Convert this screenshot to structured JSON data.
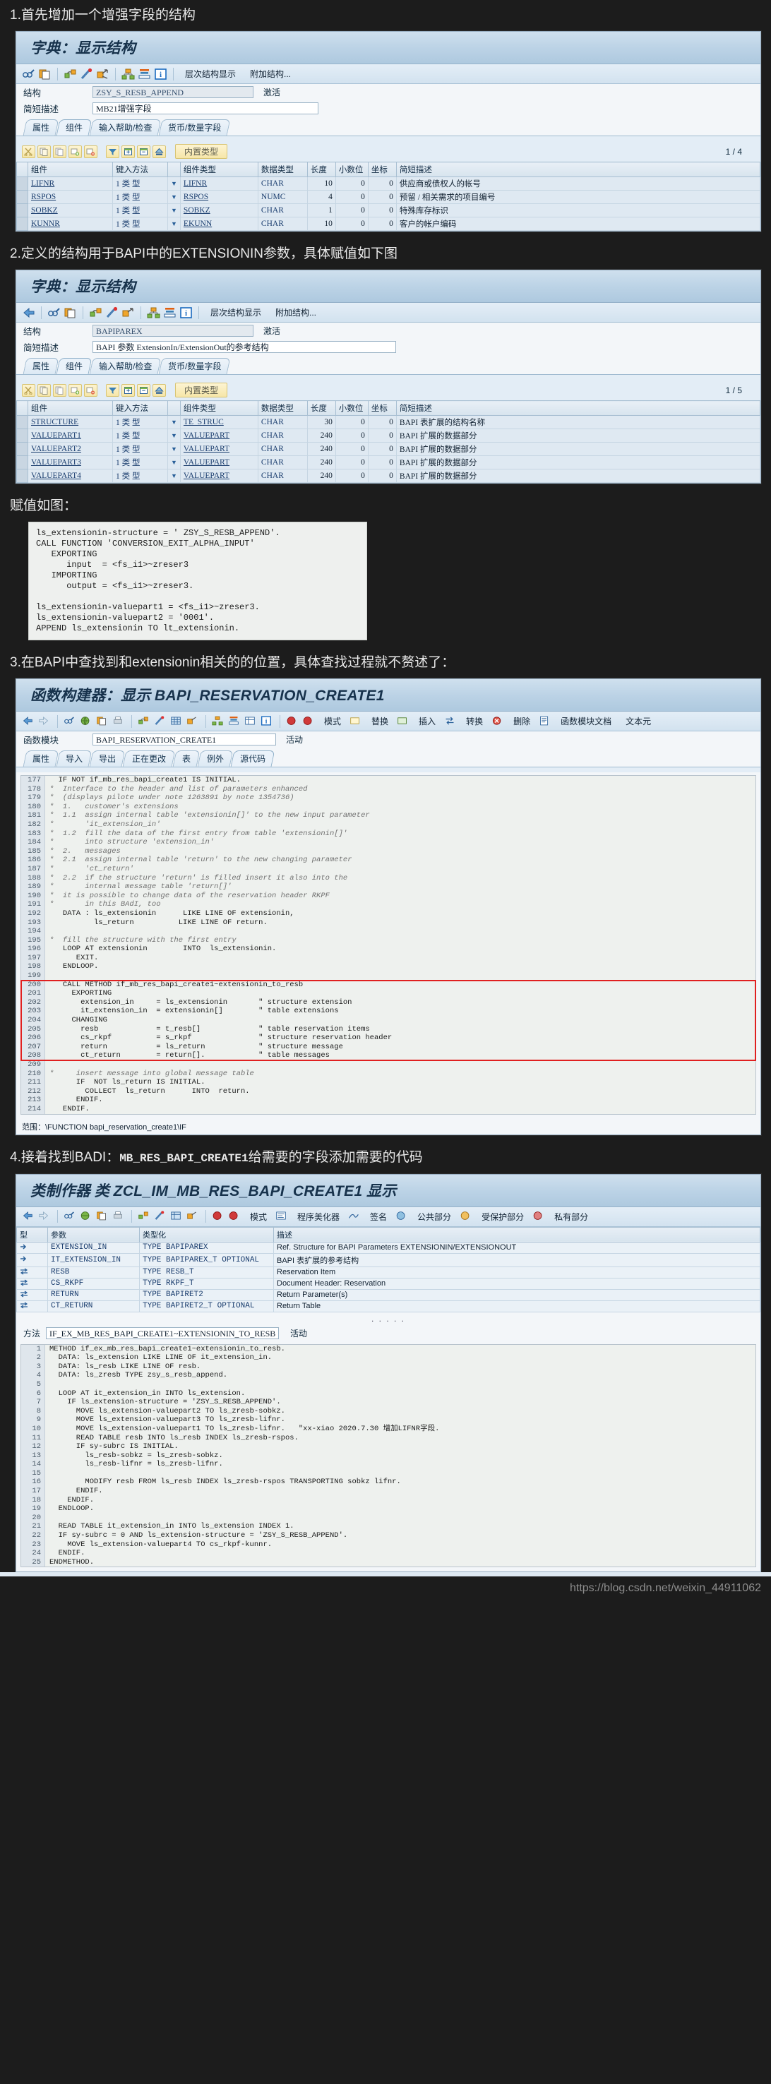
{
  "notes": {
    "n1": "1.首先增加一个增强字段的结构",
    "n2": "2.定义的结构用于BAPI中的EXTENSIONIN参数，具体赋值如下图",
    "n3_label": "赋值如图：",
    "n4_pre": "3.在BAPI中查找到和extensionin相关的的位置，具体查找过程就不赘述了：",
    "n5_pre": "4.接着找到BADI：",
    "n5_code": "MB_RES_BAPI_CREATE1",
    "n5_post": "给需要的字段添加需要的代码"
  },
  "dict1": {
    "title_cn": "字典：",
    "title_it": "显示结构",
    "toolbar_items": [
      "glasses-pencil-icon",
      "copy-icon",
      "link-icon",
      "wand-icon",
      "arrow-out-icon",
      "hierarchy-icon",
      "stack-icon",
      "info-icon"
    ],
    "toolbar_text1": "层次结构显示",
    "toolbar_text2": "附加结构...",
    "field_label_1": "结构",
    "field_value_1": "ZSY_S_RESB_APPEND",
    "field_status": "激活",
    "field_label_2": "简短描述",
    "field_value_2": "MB21增强字段",
    "tabs": [
      "属性",
      "组件",
      "输入帮助/检查",
      "货币/数量字段"
    ],
    "active_tab": "组件",
    "combo_label": "内置类型",
    "page_count": "1 / 4",
    "columns": [
      "",
      "组件",
      "键入方法",
      "",
      "组件类型",
      "数据类型",
      "长度",
      "小数位",
      "坐标",
      "简短描述"
    ],
    "rows": [
      {
        "comp": "LIFNR",
        "keym": "1  类 型",
        "ctype": "LIFNR",
        "dtype": "CHAR",
        "len": "10",
        "dec": "0",
        "coord": "0",
        "desc": "供应商或债权人的帐号"
      },
      {
        "comp": "RSPOS",
        "keym": "1  类 型",
        "ctype": "RSPOS",
        "dtype": "NUMC",
        "len": "4",
        "dec": "0",
        "coord": "0",
        "desc": "预留 / 相关需求的项目编号"
      },
      {
        "comp": "SOBKZ",
        "keym": "1  类 型",
        "ctype": "SOBKZ",
        "dtype": "CHAR",
        "len": "1",
        "dec": "0",
        "coord": "0",
        "desc": "特殊库存标识"
      },
      {
        "comp": "KUNNR",
        "keym": "1  类 型",
        "ctype": "EKUNN",
        "dtype": "CHAR",
        "len": "10",
        "dec": "0",
        "coord": "0",
        "desc": "客户的帐户编码"
      }
    ]
  },
  "dict2": {
    "title_cn": "字典：",
    "title_it": "显示结构",
    "toolbar_text1": "层次结构显示",
    "toolbar_text2": "附加结构...",
    "field_label_1": "结构",
    "field_value_1": "BAPIPAREX",
    "field_status": "激活",
    "field_label_2": "简短描述",
    "field_value_2": "BAPI 参数 ExtensionIn/ExtensionOut的参考结构",
    "tabs": [
      "属性",
      "组件",
      "输入帮助/检查",
      "货币/数量字段"
    ],
    "active_tab": "组件",
    "combo_label": "内置类型",
    "page_count": "1 / 5",
    "columns": [
      "",
      "组件",
      "键入方法",
      "",
      "组件类型",
      "数据类型",
      "长度",
      "小数位",
      "坐标",
      "简短描述"
    ],
    "rows": [
      {
        "comp": "STRUCTURE",
        "keym": "1  类 型",
        "ctype": "TE_STRUC",
        "dtype": "CHAR",
        "len": "30",
        "dec": "0",
        "coord": "0",
        "desc": "BAPI 表扩展的结构名称"
      },
      {
        "comp": "VALUEPART1",
        "keym": "1  类 型",
        "ctype": "VALUEPART",
        "dtype": "CHAR",
        "len": "240",
        "dec": "0",
        "coord": "0",
        "desc": "BAPI 扩展的数据部分"
      },
      {
        "comp": "VALUEPART2",
        "keym": "1  类 型",
        "ctype": "VALUEPART",
        "dtype": "CHAR",
        "len": "240",
        "dec": "0",
        "coord": "0",
        "desc": "BAPI 扩展的数据部分"
      },
      {
        "comp": "VALUEPART3",
        "keym": "1  类 型",
        "ctype": "VALUEPART",
        "dtype": "CHAR",
        "len": "240",
        "dec": "0",
        "coord": "0",
        "desc": "BAPI 扩展的数据部分"
      },
      {
        "comp": "VALUEPART4",
        "keym": "1  类 型",
        "ctype": "VALUEPART",
        "dtype": "CHAR",
        "len": "240",
        "dec": "0",
        "coord": "0",
        "desc": "BAPI 扩展的数据部分"
      }
    ]
  },
  "snippet": [
    "ls_extensionin-structure = ' ZSY_S_RESB_APPEND'.",
    "CALL FUNCTION 'CONVERSION_EXIT_ALPHA_INPUT'",
    "   EXPORTING",
    "      input  = <fs_i1>~zreser3",
    "   IMPORTING",
    "      output = <fs_i1>~zreser3.",
    "",
    "ls_extensionin-valuepart1 = <fs_i1>~zreser3.",
    "ls_extensionin-valuepart2 = '0001'.",
    "APPEND ls_extensionin TO lt_extensionin."
  ],
  "fnbuilder": {
    "title_cn": "函数构建器：",
    "title_mid": "显示",
    "title_name": "BAPI_RESERVATION_CREATE1",
    "toolbar_texts": [
      "模式",
      "替换",
      "插入",
      "转换",
      "删除",
      "函数模块文档",
      "文本元"
    ],
    "field_label": "函数模块",
    "field_value": "BAPI_RESERVATION_CREATE1",
    "field_status": "活动",
    "tabs": [
      "属性",
      "导入",
      "导出",
      "正在更改",
      "表",
      "例外",
      "源代码"
    ],
    "active_tab": "源代码",
    "scope": "范围：\\FUNCTION bapi_reservation_create1\\IF",
    "code": [
      {
        "n": "177",
        "t": "  IF NOT if_mb_res_bapi_create1 IS INITIAL.",
        "k": true
      },
      {
        "n": "178",
        "t": "*  Interface to the header and list of parameters enhanced",
        "c": true
      },
      {
        "n": "179",
        "t": "*  (displays pilote under note 1263891 by note 1354736)",
        "c": true
      },
      {
        "n": "180",
        "t": "*  1.   customer's extensions",
        "c": true
      },
      {
        "n": "181",
        "t": "*  1.1  assign internal table 'extensionin[]' to the new input parameter",
        "c": true
      },
      {
        "n": "182",
        "t": "*       'it_extension_in'",
        "c": true
      },
      {
        "n": "183",
        "t": "*  1.2  fill the data of the first entry from table 'extensionin[]'",
        "c": true
      },
      {
        "n": "184",
        "t": "*       into structure 'extension_in'",
        "c": true
      },
      {
        "n": "185",
        "t": "*  2.   messages",
        "c": true
      },
      {
        "n": "186",
        "t": "*  2.1  assign internal table 'return' to the new changing parameter",
        "c": true
      },
      {
        "n": "187",
        "t": "*       'ct_return'",
        "c": true
      },
      {
        "n": "188",
        "t": "*  2.2  if the structure 'return' is filled insert it also into the",
        "c": true
      },
      {
        "n": "189",
        "t": "*       internal message table 'return[]'",
        "c": true
      },
      {
        "n": "190",
        "t": "*  it is possible to change data of the reservation header RKPF",
        "c": true
      },
      {
        "n": "191",
        "t": "*       in this BAdI, too",
        "c": true
      },
      {
        "n": "192",
        "t": "   DATA : ls_extensionin      LIKE LINE OF extensionin,",
        "k": true
      },
      {
        "n": "193",
        "t": "          ls_return          LIKE LINE OF return.",
        "k": true
      },
      {
        "n": "194",
        "t": "",
        "c": false
      },
      {
        "n": "195",
        "t": "*  fill the structure with the first entry",
        "c": true
      },
      {
        "n": "196",
        "t": "   LOOP AT extensionin        INTO  ls_extensionin.",
        "k": true
      },
      {
        "n": "197",
        "t": "      EXIT.",
        "k": true
      },
      {
        "n": "198",
        "t": "   ENDLOOP.",
        "k": true
      },
      {
        "n": "199",
        "t": "",
        "c": false
      },
      {
        "n": "200",
        "t": "   CALL METHOD if_mb_res_bapi_create1~extensionin_to_resb",
        "k": true,
        "box": "start"
      },
      {
        "n": "201",
        "t": "     EXPORTING",
        "k": true,
        "box": "mid"
      },
      {
        "n": "202",
        "t": "       extension_in     = ls_extensionin       \" structure extension",
        "k": true,
        "box": "mid"
      },
      {
        "n": "203",
        "t": "       it_extension_in  = extensionin[]        \" table extensions",
        "k": true,
        "box": "mid"
      },
      {
        "n": "204",
        "t": "     CHANGING",
        "k": true,
        "box": "mid"
      },
      {
        "n": "205",
        "t": "       resb             = t_resb[]             \" table reservation items",
        "k": true,
        "box": "mid"
      },
      {
        "n": "206",
        "t": "       cs_rkpf          = s_rkpf               \" structure reservation header",
        "k": true,
        "box": "mid"
      },
      {
        "n": "207",
        "t": "       return           = ls_return            \" structure message",
        "k": true,
        "box": "mid"
      },
      {
        "n": "208",
        "t": "       ct_return        = return[].            \" table messages",
        "k": true,
        "box": "end"
      },
      {
        "n": "209",
        "t": "",
        "c": false
      },
      {
        "n": "210",
        "t": "*     insert message into global message table",
        "c": true
      },
      {
        "n": "211",
        "t": "      IF  NOT ls_return IS INITIAL.",
        "k": true
      },
      {
        "n": "212",
        "t": "        COLLECT  ls_return      INTO  return.",
        "k": true
      },
      {
        "n": "213",
        "t": "      ENDIF.",
        "k": true
      },
      {
        "n": "214",
        "t": "   ENDIF.",
        "k": true
      }
    ]
  },
  "classbuilder": {
    "title_cn": "类制作器  类",
    "title_name": "ZCL_IM_MB_RES_BAPI_CREATE1",
    "title_tail": "显示",
    "toolbar_texts": [
      "模式",
      "程序美化器",
      "签名",
      "公共部分",
      "受保护部分",
      "私有部分"
    ],
    "columns": [
      "型",
      "参数",
      "类型化",
      "描述"
    ],
    "rows": [
      {
        "icon": "import-icon",
        "param": "EXTENSION_IN",
        "typ": "TYPE BAPIPAREX",
        "desc": "Ref. Structure for BAPI Parameters EXTENSIONIN/EXTENSIONOUT"
      },
      {
        "icon": "import-icon",
        "param": "IT_EXTENSION_IN",
        "typ": "TYPE BAPIPAREX_T OPTIONAL",
        "desc": "BAPI 表扩展的参考结构"
      },
      {
        "icon": "change-icon",
        "param": "RESB",
        "typ": "TYPE RESB_T",
        "desc": "Reservation Item"
      },
      {
        "icon": "change-icon",
        "param": "CS_RKPF",
        "typ": "TYPE RKPF_T",
        "desc": "Document Header: Reservation"
      },
      {
        "icon": "change-icon",
        "param": "RETURN",
        "typ": "TYPE BAPIRET2",
        "desc": "Return Parameter(s)"
      },
      {
        "icon": "change-icon",
        "param": "CT_RETURN",
        "typ": "TYPE BAPIRET2_T OPTIONAL",
        "desc": "Return Table"
      }
    ],
    "dots": ". . . . .",
    "method_label": "方法",
    "method_value": "IF_EX_MB_RES_BAPI_CREATE1~EXTENSIONIN_TO_RESB",
    "method_status": "活动",
    "code": [
      {
        "n": "1",
        "t": "METHOD if_ex_mb_res_bapi_create1~extensionin_to_resb."
      },
      {
        "n": "2",
        "t": "  DATA: ls_extension LIKE LINE OF it_extension_in."
      },
      {
        "n": "3",
        "t": "  DATA: ls_resb LIKE LINE OF resb."
      },
      {
        "n": "4",
        "t": "  DATA: ls_zresb TYPE zsy_s_resb_append."
      },
      {
        "n": "5",
        "t": ""
      },
      {
        "n": "6",
        "t": "  LOOP AT it_extension_in INTO ls_extension."
      },
      {
        "n": "7",
        "t": "    IF ls_extension-structure = 'ZSY_S_RESB_APPEND'."
      },
      {
        "n": "8",
        "t": "      MOVE ls_extension-valuepart2 TO ls_zresb-sobkz."
      },
      {
        "n": "9",
        "t": "      MOVE ls_extension-valuepart3 TO ls_zresb-lifnr."
      },
      {
        "n": "10",
        "t": "      MOVE ls_extension-valuepart1 TO ls_zresb-lifnr.   \"xx-xiao 2020.7.30 增加LIFNR字段."
      },
      {
        "n": "11",
        "t": "      READ TABLE resb INTO ls_resb INDEX ls_zresb-rspos."
      },
      {
        "n": "12",
        "t": "      IF sy-subrc IS INITIAL."
      },
      {
        "n": "13",
        "t": "        ls_resb-sobkz = ls_zresb-sobkz."
      },
      {
        "n": "14",
        "t": "        ls_resb-lifnr = ls_zresb-lifnr."
      },
      {
        "n": "15",
        "t": ""
      },
      {
        "n": "16",
        "t": "        MODIFY resb FROM ls_resb INDEX ls_zresb-rspos TRANSPORTING sobkz lifnr."
      },
      {
        "n": "17",
        "t": "      ENDIF."
      },
      {
        "n": "18",
        "t": "    ENDIF."
      },
      {
        "n": "19",
        "t": "  ENDLOOP."
      },
      {
        "n": "20",
        "t": ""
      },
      {
        "n": "21",
        "t": "  READ TABLE it_extension_in INTO ls_extension INDEX 1."
      },
      {
        "n": "22",
        "t": "  IF sy-subrc = 0 AND ls_extension-structure = 'ZSY_S_RESB_APPEND'."
      },
      {
        "n": "23",
        "t": "    MOVE ls_extension-valuepart4 TO cs_rkpf-kunnr."
      },
      {
        "n": "24",
        "t": "  ENDIF."
      },
      {
        "n": "25",
        "t": "ENDMETHOD."
      }
    ]
  },
  "watermark": "https://blog.csdn.net/weixin_44911062"
}
